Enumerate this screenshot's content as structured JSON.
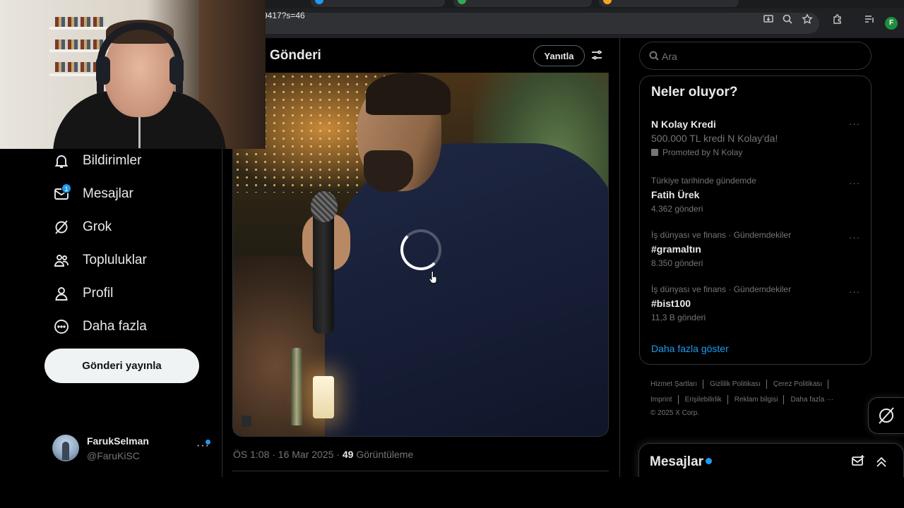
{
  "browser": {
    "url_fragment": "9417?s=46",
    "profile_initial": "F",
    "tabs": [
      {
        "label": "",
        "favicon_color": "#1d9bf0"
      },
      {
        "label": "",
        "favicon_color": "#34a853"
      },
      {
        "label": "",
        "favicon_color": "#f4a623"
      }
    ]
  },
  "nav": {
    "items": [
      {
        "label": "Bildirimler",
        "icon": "bell-icon"
      },
      {
        "label": "Mesajlar",
        "icon": "mail-icon",
        "badge": "1"
      },
      {
        "label": "Grok",
        "icon": "grok-icon"
      },
      {
        "label": "Topluluklar",
        "icon": "communities-icon"
      },
      {
        "label": "Profil",
        "icon": "profile-icon"
      },
      {
        "label": "Daha fazla",
        "icon": "more-circle-icon"
      }
    ],
    "post_button": "Gönderi yayınla",
    "account": {
      "name": "FarukSelman",
      "handle": "@FaruKiSC",
      "more": "···"
    }
  },
  "center": {
    "title": "Gönderi",
    "reply_button": "Yanıtla",
    "meta": {
      "time": "ÖS 1:08 · 16 Mar 2025 · ",
      "views": "49",
      "views_label": " Görüntüleme"
    }
  },
  "right": {
    "search_placeholder": "Ara",
    "trends_title": "Neler oluyor?",
    "promoted": {
      "name": "N Kolay Kredi",
      "desc": "500.000 TL kredi N Kolay'da!",
      "promo": "Promoted by N Kolay"
    },
    "trends": [
      {
        "context": "Türkiye tarihinde gündemde",
        "name": "Fatih Ürek",
        "count": "4.362 gönderi"
      },
      {
        "context": "İş dünyası ve finans · Gündemdekiler",
        "name": "#gramaltın",
        "count": "8.350 gönderi"
      },
      {
        "context": "İş dünyası ve finans · Gündemdekiler",
        "name": "#bist100",
        "count": "11,3 B gönderi"
      }
    ],
    "more_dots": "···",
    "show_more": "Daha fazla göster",
    "footer": {
      "links_row1": [
        "Hizmet Şartları",
        "Gizlilik Politikası",
        "Çerez Politikası"
      ],
      "links_row2": [
        "Imprint",
        "Erişilebilirlik",
        "Reklam bilgisi",
        "Daha fazla ···"
      ],
      "copyright": "© 2025 X Corp."
    },
    "messages_drawer": {
      "title": "Mesajlar"
    }
  },
  "colors": {
    "accent": "#1d9bf0",
    "background": "#000000",
    "text": "#e7e9ea",
    "muted": "#71767b",
    "border": "#2f3336"
  }
}
